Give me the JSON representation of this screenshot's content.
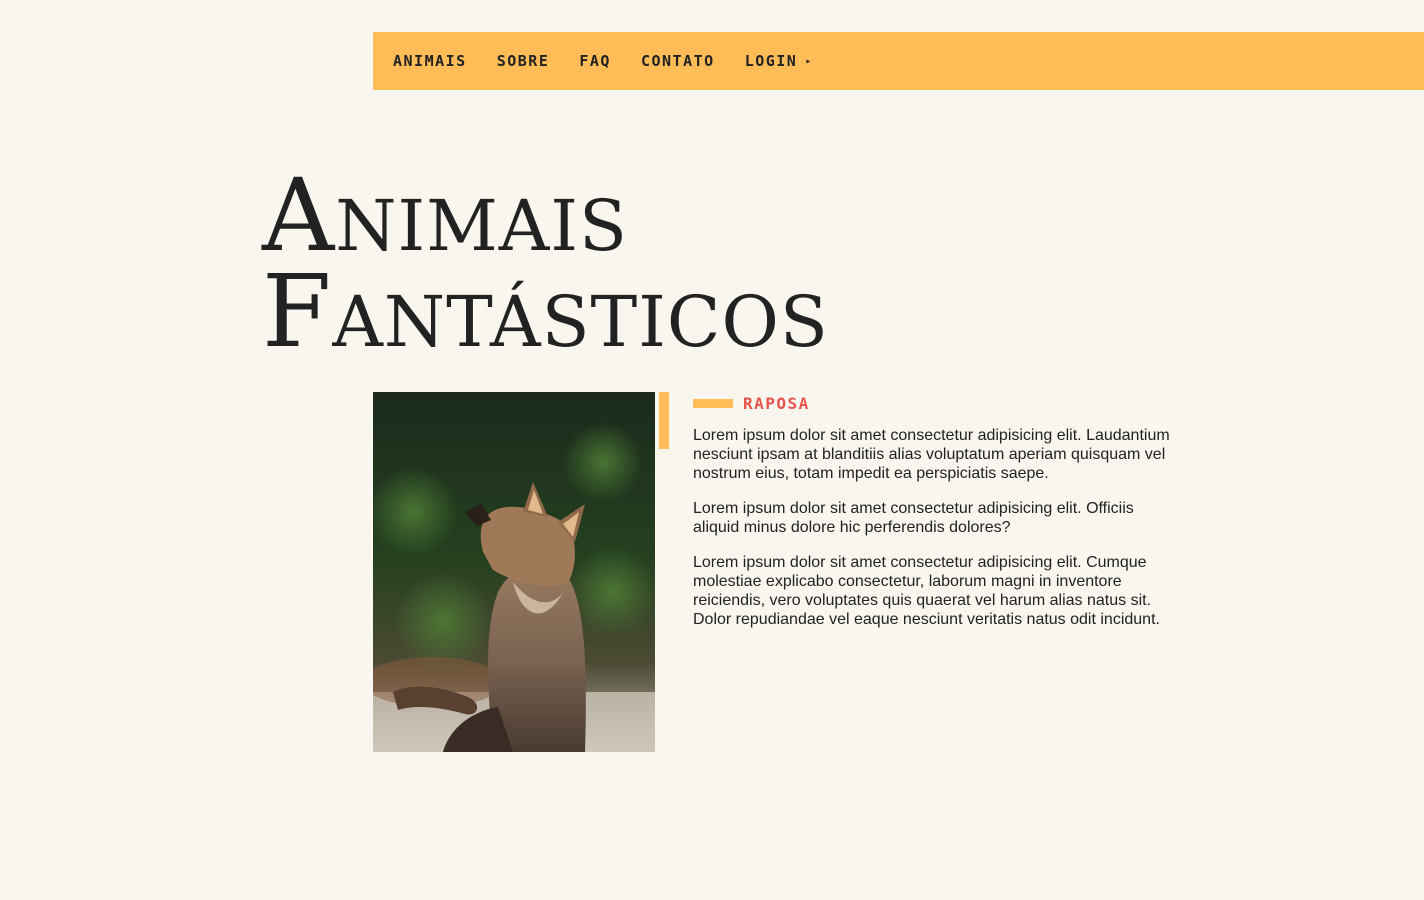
{
  "nav": {
    "items": [
      "ANIMAIS",
      "SOBRE",
      "FAQ",
      "CONTATO"
    ],
    "login_label": "LOGIN",
    "login_arrow": "▸"
  },
  "hero": {
    "line1": "Animais",
    "line2": "Fantásticos"
  },
  "article": {
    "label": "RAPOSA",
    "paragraphs": [
      "Lorem ipsum dolor sit amet consectetur adipisicing elit. Laudantium nesciunt ipsam at blanditiis alias voluptatum aperiam quisquam vel nostrum eius, totam impedit ea perspiciatis saepe.",
      "Lorem ipsum dolor sit amet consectetur adipisicing elit. Officiis aliquid minus dolore hic perferendis dolores?",
      "Lorem ipsum dolor sit amet consectetur adipisicing elit. Cumque molestiae explicabo consectetur, laborum magni in inventore reiciendis, vero voluptates quis quaerat vel harum alias natus sit. Dolor repudiandae vel eaque nesciunt veritatis natus odit incidunt."
    ]
  },
  "colors": {
    "background": "#f9f5ef",
    "accent": "#ffbc57",
    "label": "#e5534b",
    "text": "#222222"
  }
}
